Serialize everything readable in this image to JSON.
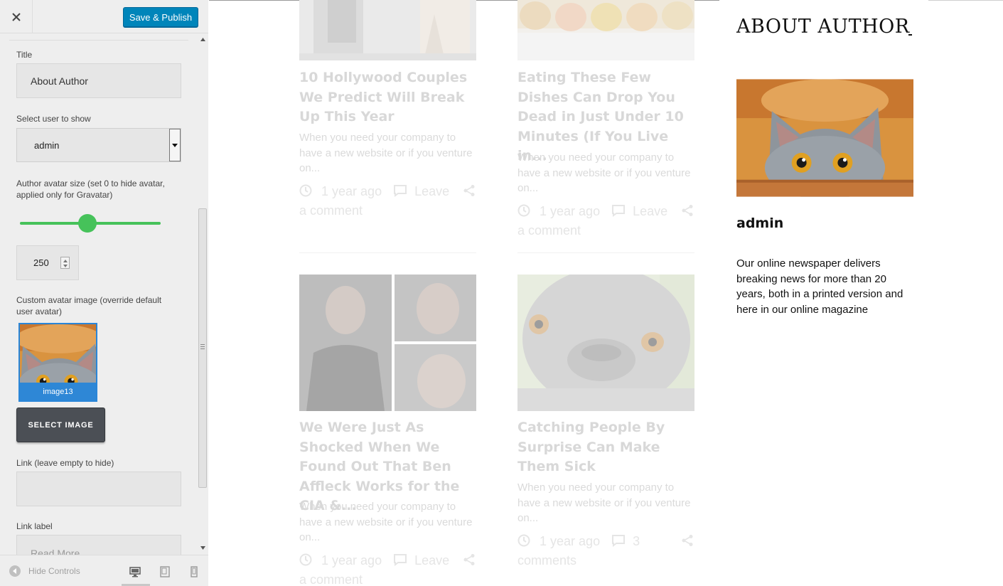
{
  "header": {
    "close_label": "×",
    "publish_label": "Save & Publish",
    "publish_color": "#0085ba"
  },
  "form": {
    "title_label": "Title",
    "title_value": "About Author",
    "user_label": "Select user to show",
    "user_value": "admin",
    "avatar_size_label_1": "Author avatar size (set 0 to hide avatar,",
    "avatar_size_label_2": "applied only for Gravatar)",
    "avatar_size_value": "250",
    "custom_avatar_label_1": "Custom avatar image (override default",
    "custom_avatar_label_2": "user avatar)",
    "image_caption": "image13",
    "select_image_label": "SELECT IMAGE",
    "link_label": "Link (leave empty to hide)",
    "link_value": "",
    "link_text_label": "Link label",
    "link_text_placeholder": "Read More",
    "slider_color": "#46c25a"
  },
  "footer": {
    "hide_controls_label": "Hide Controls",
    "devices": [
      "desktop-icon",
      "tablet-icon",
      "mobile-icon"
    ]
  },
  "posts": [
    {
      "title": "10 Hollywood Couples We Predict Will Break Up This Year",
      "excerpt": "When you need your company to have a new website or if you venture on...",
      "time": "1 year ago",
      "comments_a": "Leave",
      "comments_b": "a comment"
    },
    {
      "title": "Eating These Few Dishes Can Drop You Dead in Just Under 10 Minutes (If You Live in...",
      "excerpt": "When you need your company to have a new website or if you venture on...",
      "time": "1 year ago",
      "comments_a": "Leave",
      "comments_b": "a comment"
    },
    {
      "title": "We Were Just As Shocked When We Found Out That Ben Affleck Works for the CIA &...",
      "excerpt": "When you need your company to have a new website or if you venture on...",
      "time": "1 year ago",
      "comments_a": "Leave",
      "comments_b": "a comment"
    },
    {
      "title": "Catching People By Surprise Can Make Them Sick",
      "excerpt": "When you need your company to have a new website or if you venture on...",
      "time": "1 year ago",
      "comments_a": "3",
      "comments_b": "comments"
    }
  ],
  "widget": {
    "title": "ABOUT AUTHOR",
    "name": "admin",
    "bio": "Our online newspaper delivers breaking news for more than 20 years, both in a printed version and here in our online magazine"
  }
}
